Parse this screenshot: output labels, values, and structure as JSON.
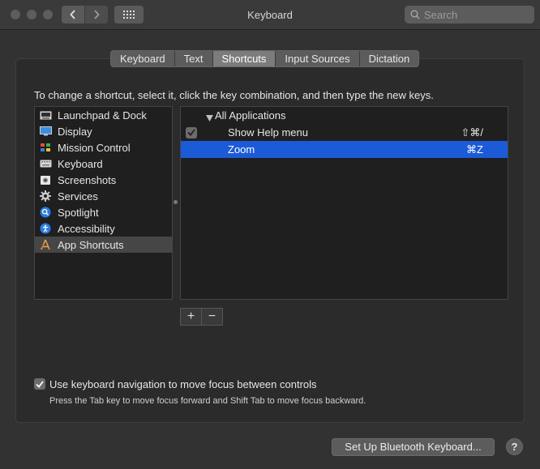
{
  "window": {
    "title": "Keyboard"
  },
  "toolbar": {
    "back_icon": "chevron-left-icon",
    "forward_icon": "chevron-right-icon",
    "grid_icon": "show-all-grid-icon",
    "search_placeholder": "Search"
  },
  "tabs": [
    {
      "label": "Keyboard",
      "active": false
    },
    {
      "label": "Text",
      "active": false
    },
    {
      "label": "Shortcuts",
      "active": true
    },
    {
      "label": "Input Sources",
      "active": false
    },
    {
      "label": "Dictation",
      "active": false
    }
  ],
  "instruction": "To change a shortcut, select it, click the key combination, and then type the new keys.",
  "categories": [
    {
      "label": "Launchpad & Dock",
      "icon": "launchpad-dock-icon"
    },
    {
      "label": "Display",
      "icon": "display-icon"
    },
    {
      "label": "Mission Control",
      "icon": "mission-control-icon"
    },
    {
      "label": "Keyboard",
      "icon": "keyboard-icon"
    },
    {
      "label": "Screenshots",
      "icon": "screenshots-icon"
    },
    {
      "label": "Services",
      "icon": "gear-icon"
    },
    {
      "label": "Spotlight",
      "icon": "spotlight-icon"
    },
    {
      "label": "Accessibility",
      "icon": "accessibility-icon"
    },
    {
      "label": "App Shortcuts",
      "icon": "app-shortcuts-icon",
      "selected": true
    }
  ],
  "shortcuts": {
    "group_label": "All Applications",
    "items": [
      {
        "label": "Show Help menu",
        "key": "⇧⌘/",
        "checked": true,
        "selected": false
      },
      {
        "label": "Zoom",
        "key": "⌘Z",
        "checked": false,
        "selected": true
      }
    ]
  },
  "add_label": "+",
  "remove_label": "−",
  "keyboard_navigation": {
    "label": "Use keyboard navigation to move focus between controls",
    "checked": true,
    "hint": "Press the Tab key to move focus forward and Shift Tab to move focus backward."
  },
  "bluetooth_button_label": "Set Up Bluetooth Keyboard...",
  "help_label": "?",
  "colors": {
    "selection": "#1c5bd8",
    "window_bg": "#323232"
  }
}
